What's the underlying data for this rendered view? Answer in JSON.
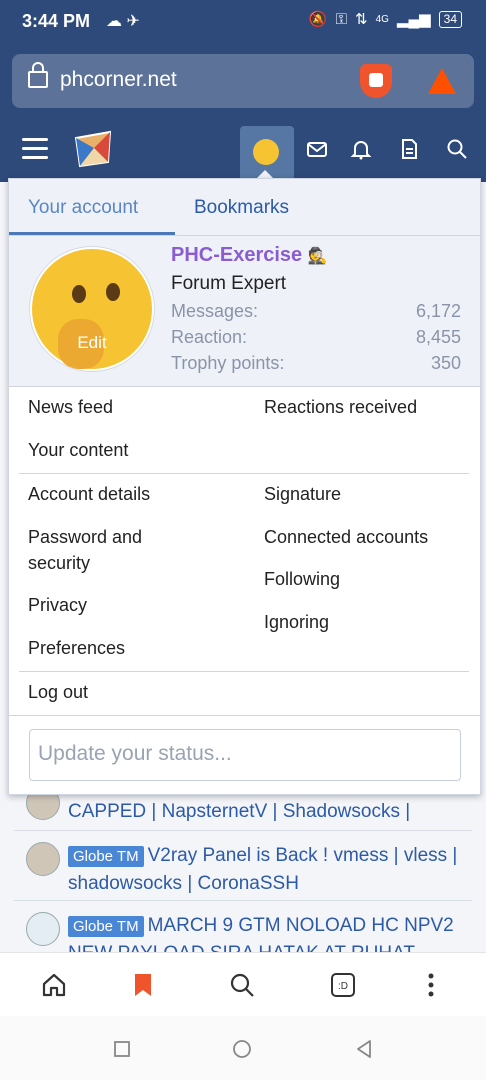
{
  "status_bar": {
    "time": "3:44 PM",
    "battery": "34",
    "network": "4G"
  },
  "browser": {
    "url": "phcorner.net"
  },
  "menu": {
    "tabs": [
      {
        "label": "Your account"
      },
      {
        "label": "Bookmarks"
      }
    ],
    "profile": {
      "username": "PHC-Exercise",
      "user_title": "Forum Expert",
      "edit_label": "Edit",
      "stats": [
        {
          "label": "Messages:",
          "value": "6,172"
        },
        {
          "label": "Reaction:",
          "value": "8,455"
        },
        {
          "label": "Trophy points:",
          "value": "350"
        }
      ]
    },
    "links": {
      "news_feed": "News feed",
      "reactions_received": "Reactions received",
      "your_content": "Your content",
      "account_details": "Account details",
      "signature": "Signature",
      "password_security_line1": "Password and",
      "password_security_line2": "security",
      "connected_accounts": "Connected accounts",
      "following": "Following",
      "privacy": "Privacy",
      "ignoring": "Ignoring",
      "preferences": "Preferences",
      "log_out": "Log out"
    },
    "status_placeholder": "Update your status..."
  },
  "threads": [
    {
      "prefix": "",
      "title": "CAPPED | NapsternetV | Shadowsocks |"
    },
    {
      "prefix": "Globe TM",
      "title": "V2ray Panel is Back ! vmess | vless | shadowsocks | CoronaSSH"
    },
    {
      "prefix": "Globe TM",
      "title": "MARCH 9 GTM NOLOAD HC NPV2 NEW PAYLOAD SIRA HATAK AT RUHAT"
    }
  ]
}
